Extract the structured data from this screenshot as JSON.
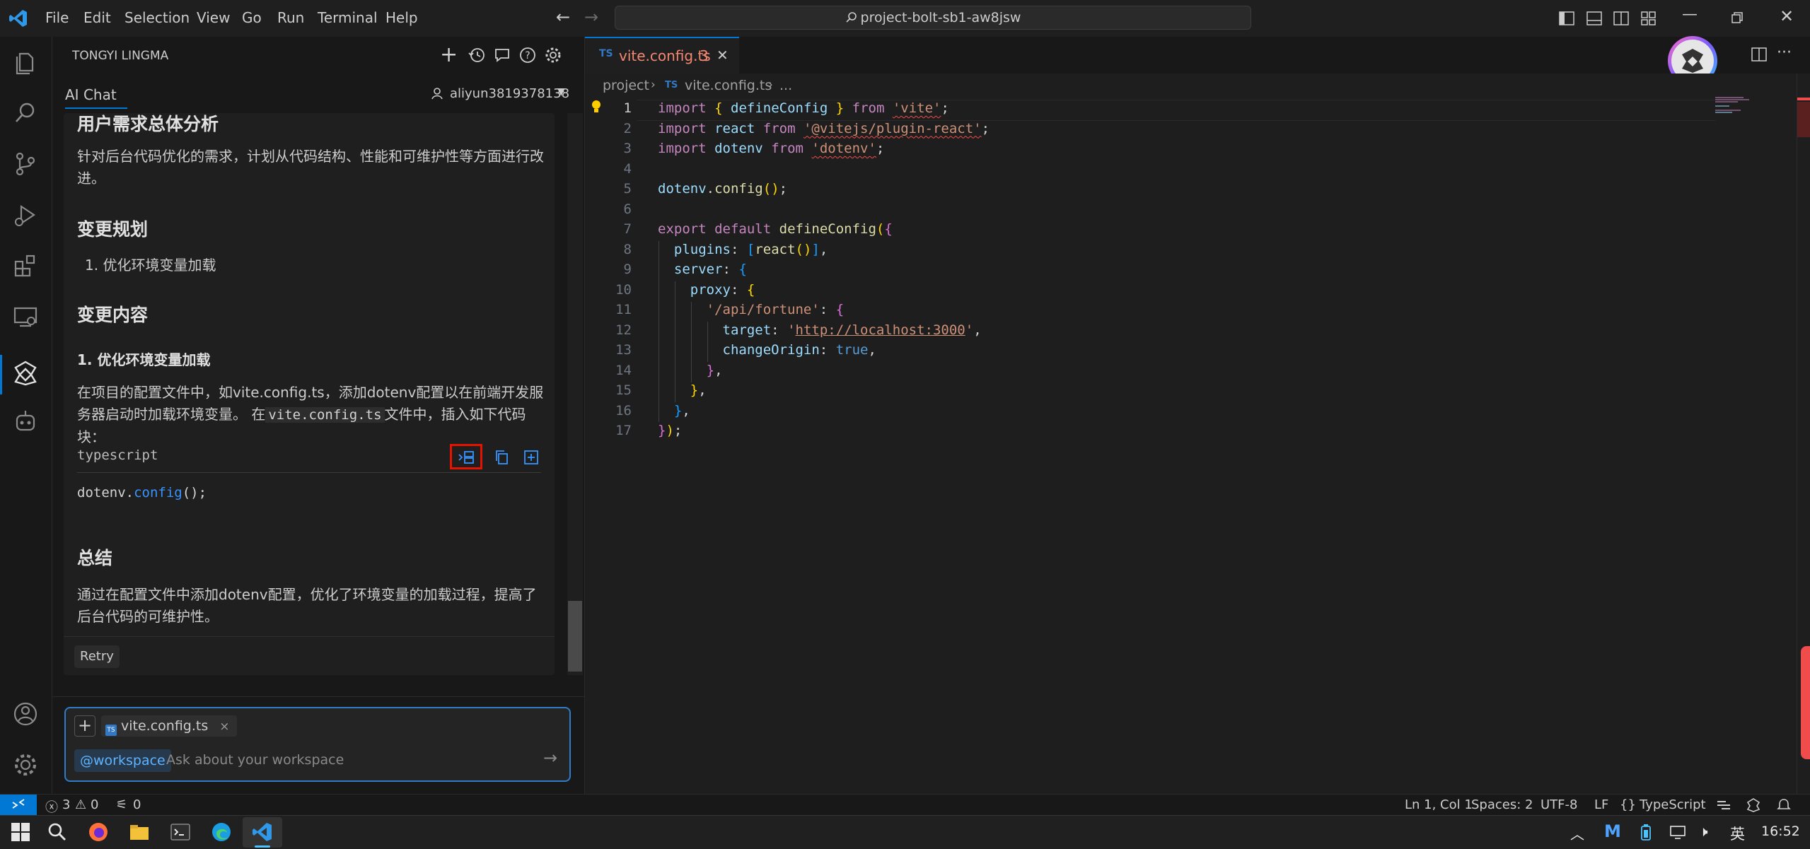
{
  "titlebar": {
    "menu": [
      "File",
      "Edit",
      "Selection",
      "View",
      "Go",
      "Run",
      "Terminal",
      "Help"
    ],
    "search": "project-bolt-sb1-aw8jsw"
  },
  "sidepanel": {
    "title": "TONGYI LINGMA",
    "tab": "AI Chat",
    "user": "aliyun3819378138"
  },
  "chat": {
    "h_analysis": "用户需求总体分析",
    "p_analysis": "针对后台代码优化的需求，计划从代码结构、性能和可维护性等方面进行改进。",
    "h_plan": "变更规划",
    "plan_item": "1. 优化环境变量加载",
    "h_content": "变更内容",
    "h3_item": "1. 优化环境变量加载",
    "p_content_1": "在项目的配置文件中，如vite.config.ts，添加dotenv配置以在前端开发服务器启动时加载环境变量。 在",
    "p_content_code": "vite.config.ts",
    "p_content_2": "文件中，插入如下代码块：",
    "code_lang": "typescript",
    "code_obj": "dotenv.",
    "code_fn": "config",
    "code_rest": "();",
    "h_summary": "总结",
    "p_summary": "通过在配置文件中添加dotenv配置，优化了环境变量的加载过程，提高了后台代码的可维护性。",
    "retry": "Retry"
  },
  "input": {
    "file_chip": "vite.config.ts",
    "chip_close": "×",
    "workspace": "@workspace",
    "placeholder": "Ask about your workspace"
  },
  "editor": {
    "tab_label": "vite.config.ts",
    "tab_badge": "3",
    "tab_close": "✕",
    "breadcrumb_project": "project",
    "breadcrumb_file": "vite.config.ts",
    "breadcrumb_more": "...",
    "line_numbers": [
      "1",
      "2",
      "3",
      "4",
      "5",
      "6",
      "7",
      "8",
      "9",
      "10",
      "11",
      "12",
      "13",
      "14",
      "15",
      "16",
      "17"
    ],
    "code_lines": [
      "import { defineConfig } from 'vite';",
      "import react from '@vitejs/plugin-react';",
      "import dotenv from 'dotenv';",
      "",
      "dotenv.config();",
      "",
      "export default defineConfig({",
      "  plugins: [react()],",
      "  server: {",
      "    proxy: {",
      "      '/api/fortune': {",
      "        target: 'http://localhost:3000',",
      "        changeOrigin: true,",
      "      },",
      "    },",
      "  },",
      "});"
    ]
  },
  "statusbar": {
    "errors": "3",
    "warnings": "0",
    "ports": "0",
    "position": "Ln 1, Col 1",
    "spaces": "Spaces: 2",
    "encoding": "UTF-8",
    "eol": "LF",
    "language": "TypeScript"
  },
  "taskbar": {
    "ime": "英",
    "time": "16:52"
  },
  "colors": {
    "accent": "#0078d4",
    "highlight_box": "#e51400"
  }
}
